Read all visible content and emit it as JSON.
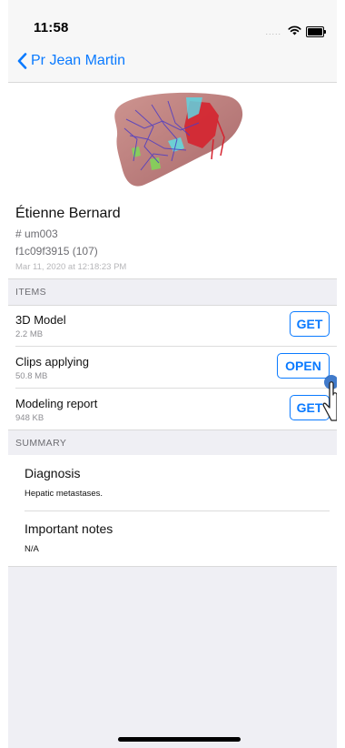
{
  "status_bar": {
    "time": "11:58",
    "signal_dots": "....."
  },
  "nav": {
    "back_label": "Pr Jean Martin"
  },
  "patient": {
    "name": "Étienne Bernard",
    "id": "# um003",
    "hash": "f1c09f3915 (107)",
    "date": "Mar 11, 2020 at 12:18:23 PM"
  },
  "items_section": {
    "header": "ITEMS"
  },
  "items": [
    {
      "title": "3D Model",
      "size": "2.2 MB",
      "action": "GET"
    },
    {
      "title": "Clips applying",
      "size": "50.8 MB",
      "action": "OPEN"
    },
    {
      "title": "Modeling report",
      "size": "948 KB",
      "action": "GET"
    }
  ],
  "summary_section": {
    "header": "SUMMARY"
  },
  "summary": {
    "diagnosis_title": "Diagnosis",
    "diagnosis_text": "Hepatic metastases.",
    "notes_title": "Important notes",
    "notes_text": "N/A"
  },
  "colors": {
    "accent": "#0a7aff",
    "liver": "#b96a6a",
    "vessels": "#5a4fbf"
  },
  "icons": {
    "back": "chevron-left-icon",
    "wifi": "wifi-icon",
    "battery": "battery-icon",
    "touch": "hand-pointer-icon"
  }
}
